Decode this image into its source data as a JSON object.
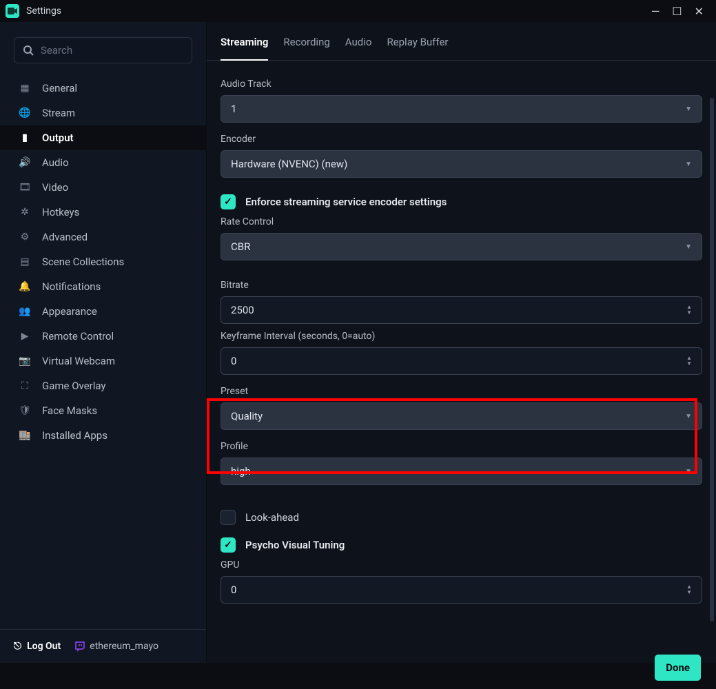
{
  "window": {
    "title": "Settings"
  },
  "search": {
    "placeholder": "Search"
  },
  "sidebar": {
    "items": [
      {
        "label": "General"
      },
      {
        "label": "Stream"
      },
      {
        "label": "Output"
      },
      {
        "label": "Audio"
      },
      {
        "label": "Video"
      },
      {
        "label": "Hotkeys"
      },
      {
        "label": "Advanced"
      },
      {
        "label": "Scene Collections"
      },
      {
        "label": "Notifications"
      },
      {
        "label": "Appearance"
      },
      {
        "label": "Remote Control"
      },
      {
        "label": "Virtual Webcam"
      },
      {
        "label": "Game Overlay"
      },
      {
        "label": "Face Masks"
      },
      {
        "label": "Installed Apps"
      }
    ],
    "logout": "Log Out",
    "username": "ethereum_mayo"
  },
  "tabs": [
    {
      "label": "Streaming"
    },
    {
      "label": "Recording"
    },
    {
      "label": "Audio"
    },
    {
      "label": "Replay Buffer"
    }
  ],
  "fields": {
    "audio_track": {
      "label": "Audio Track",
      "value": "1"
    },
    "encoder": {
      "label": "Encoder",
      "value": "Hardware (NVENC) (new)"
    },
    "enforce": {
      "label": "Enforce streaming service encoder settings"
    },
    "rate_control": {
      "label": "Rate Control",
      "value": "CBR"
    },
    "bitrate": {
      "label": "Bitrate",
      "value": "2500"
    },
    "keyframe": {
      "label": "Keyframe Interval (seconds, 0=auto)",
      "value": "0"
    },
    "preset": {
      "label": "Preset",
      "value": "Quality"
    },
    "profile": {
      "label": "Profile",
      "value": "high"
    },
    "lookahead": {
      "label": "Look-ahead"
    },
    "psycho": {
      "label": "Psycho Visual Tuning"
    },
    "gpu": {
      "label": "GPU",
      "value": "0"
    }
  },
  "buttons": {
    "done": "Done"
  }
}
